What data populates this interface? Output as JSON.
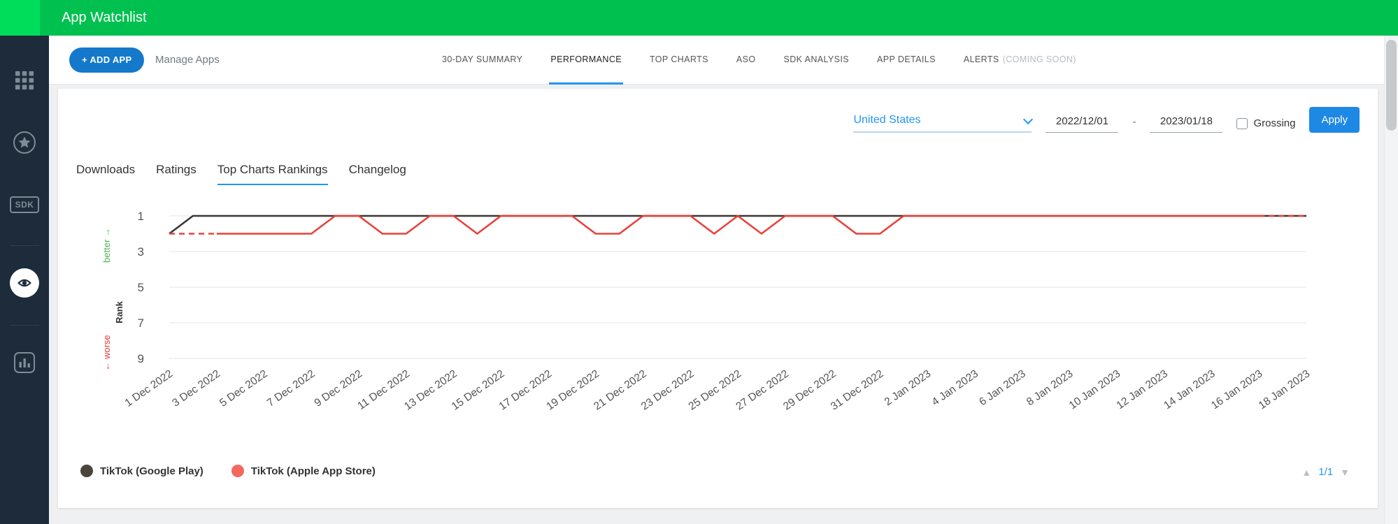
{
  "header": {
    "title": "App Watchlist"
  },
  "sidebar": {
    "items": [
      {
        "name": "apps-grid"
      },
      {
        "name": "featured-star"
      },
      {
        "name": "sdk",
        "label": "SDK"
      },
      {
        "name": "watchlist-eye",
        "active": true
      },
      {
        "name": "analytics-chart"
      }
    ]
  },
  "toolbar": {
    "add_app": "+ ADD APP",
    "manage_apps": "Manage Apps",
    "tabs": [
      {
        "label": "30-DAY SUMMARY"
      },
      {
        "label": "PERFORMANCE",
        "active": true
      },
      {
        "label": "TOP CHARTS"
      },
      {
        "label": "ASO"
      },
      {
        "label": "SDK ANALYSIS"
      },
      {
        "label": "APP DETAILS"
      },
      {
        "label": "ALERTS",
        "suffix": "(COMING SOON)"
      }
    ]
  },
  "filters": {
    "country": "United States",
    "date_from": "2022/12/01",
    "date_separator": "-",
    "date_to": "2023/01/18",
    "grossing": "Grossing",
    "apply": "Apply"
  },
  "panel_tabs": [
    {
      "label": "Downloads"
    },
    {
      "label": "Ratings"
    },
    {
      "label": "Top Charts Rankings",
      "active": true
    },
    {
      "label": "Changelog"
    }
  ],
  "chart_data": {
    "type": "line",
    "ylabel": "Rank",
    "better_label": "better →",
    "worse_label": "← worse",
    "y_inverted": true,
    "y_range": [
      1,
      9
    ],
    "y_ticks": [
      1,
      3,
      5,
      7,
      9
    ],
    "num_days": 49,
    "x_tick_step_days": 2,
    "x_tick_labels": [
      "1 Dec 2022",
      "3 Dec 2022",
      "5 Dec 2022",
      "7 Dec 2022",
      "9 Dec 2022",
      "11 Dec 2022",
      "13 Dec 2022",
      "15 Dec 2022",
      "17 Dec 2022",
      "19 Dec 2022",
      "21 Dec 2022",
      "23 Dec 2022",
      "25 Dec 2022",
      "27 Dec 2022",
      "29 Dec 2022",
      "31 Dec 2022",
      "2 Jan 2023",
      "4 Jan 2023",
      "6 Jan 2023",
      "8 Jan 2023",
      "10 Jan 2023",
      "12 Jan 2023",
      "14 Jan 2023",
      "16 Jan 2023",
      "18 Jan 2023"
    ],
    "series": [
      {
        "name": "TikTok (Google Play)",
        "color": "#3b3733",
        "values": [
          2,
          1,
          1,
          1,
          1,
          1,
          1,
          1,
          1,
          1,
          1,
          1,
          1,
          1,
          1,
          1,
          1,
          1,
          1,
          1,
          1,
          1,
          1,
          1,
          1,
          1,
          1,
          1,
          1,
          1,
          1,
          1,
          1,
          1,
          1,
          1,
          1,
          1,
          1,
          1,
          1,
          1,
          1,
          1,
          1,
          1,
          1,
          1,
          1
        ]
      },
      {
        "name": "TikTok (Apple App Store)",
        "color": "#e8423b",
        "dashed_head_points": 2,
        "dashed_tail_points": 2,
        "values": [
          2,
          2,
          2,
          2,
          2,
          2,
          2,
          1,
          1,
          2,
          2,
          1,
          1,
          2,
          1,
          1,
          1,
          1,
          2,
          2,
          1,
          1,
          1,
          2,
          1,
          2,
          1,
          1,
          1,
          2,
          2,
          1,
          1,
          1,
          1,
          1,
          1,
          1,
          1,
          1,
          1,
          1,
          1,
          1,
          1,
          1,
          1,
          1,
          1
        ]
      }
    ]
  },
  "legend": {
    "items": [
      {
        "label": "TikTok (Google Play)",
        "color": "#4a443a"
      },
      {
        "label": "TikTok (Apple App Store)",
        "color": "#f4695e"
      }
    ]
  },
  "pagination": {
    "up": "▲",
    "page": "1/1",
    "down": "▼"
  }
}
